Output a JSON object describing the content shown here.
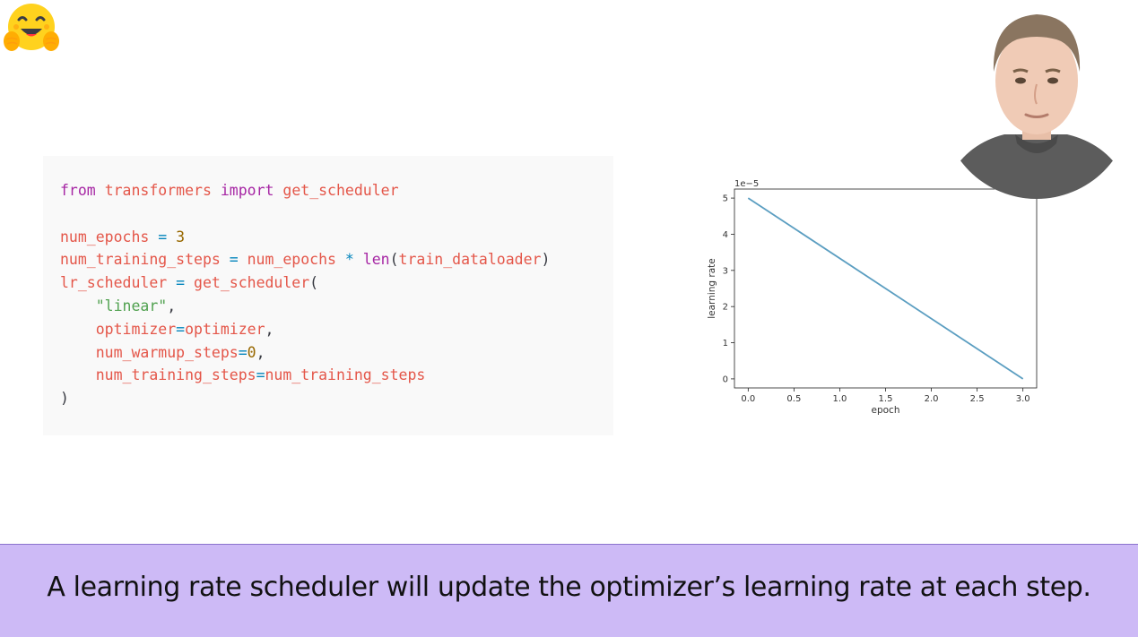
{
  "code": {
    "lines": [
      [
        {
          "t": "from",
          "c": "kw"
        },
        {
          "t": " ",
          "c": "pl"
        },
        {
          "t": "transformers",
          "c": "id"
        },
        {
          "t": " ",
          "c": "pl"
        },
        {
          "t": "import",
          "c": "kw"
        },
        {
          "t": " ",
          "c": "pl"
        },
        {
          "t": "get_scheduler",
          "c": "id"
        }
      ],
      [],
      [
        {
          "t": "num_epochs",
          "c": "id"
        },
        {
          "t": " ",
          "c": "pl"
        },
        {
          "t": "=",
          "c": "op"
        },
        {
          "t": " ",
          "c": "pl"
        },
        {
          "t": "3",
          "c": "num"
        }
      ],
      [
        {
          "t": "num_training_steps",
          "c": "id"
        },
        {
          "t": " ",
          "c": "pl"
        },
        {
          "t": "=",
          "c": "op"
        },
        {
          "t": " ",
          "c": "pl"
        },
        {
          "t": "num_epochs",
          "c": "id"
        },
        {
          "t": " ",
          "c": "pl"
        },
        {
          "t": "*",
          "c": "op"
        },
        {
          "t": " ",
          "c": "pl"
        },
        {
          "t": "len",
          "c": "kw"
        },
        {
          "t": "(",
          "c": "pl"
        },
        {
          "t": "train_dataloader",
          "c": "id"
        },
        {
          "t": ")",
          "c": "pl"
        }
      ],
      [
        {
          "t": "lr_scheduler",
          "c": "id"
        },
        {
          "t": " ",
          "c": "pl"
        },
        {
          "t": "=",
          "c": "op"
        },
        {
          "t": " ",
          "c": "pl"
        },
        {
          "t": "get_scheduler",
          "c": "id"
        },
        {
          "t": "(",
          "c": "pl"
        }
      ],
      [
        {
          "t": "    ",
          "c": "pl"
        },
        {
          "t": "\"linear\"",
          "c": "str"
        },
        {
          "t": ",",
          "c": "pl"
        }
      ],
      [
        {
          "t": "    ",
          "c": "pl"
        },
        {
          "t": "optimizer",
          "c": "id"
        },
        {
          "t": "=",
          "c": "op"
        },
        {
          "t": "optimizer",
          "c": "id"
        },
        {
          "t": ",",
          "c": "pl"
        }
      ],
      [
        {
          "t": "    ",
          "c": "pl"
        },
        {
          "t": "num_warmup_steps",
          "c": "id"
        },
        {
          "t": "=",
          "c": "op"
        },
        {
          "t": "0",
          "c": "num"
        },
        {
          "t": ",",
          "c": "pl"
        }
      ],
      [
        {
          "t": "    ",
          "c": "pl"
        },
        {
          "t": "num_training_steps",
          "c": "id"
        },
        {
          "t": "=",
          "c": "op"
        },
        {
          "t": "num_training_steps",
          "c": "id"
        }
      ],
      [
        {
          "t": ")",
          "c": "pl"
        }
      ]
    ]
  },
  "chart_data": {
    "type": "line",
    "xlabel": "epoch",
    "ylabel": "learning rate",
    "y_scale_label": "1e−5",
    "xlim": [
      -0.15,
      3.15
    ],
    "ylim": [
      -0.25,
      5.25
    ],
    "x_ticks": [
      0.0,
      0.5,
      1.0,
      1.5,
      2.0,
      2.5,
      3.0
    ],
    "x_tick_labels": [
      "0.0",
      "0.5",
      "1.0",
      "1.5",
      "2.0",
      "2.5",
      "3.0"
    ],
    "y_ticks": [
      0,
      1,
      2,
      3,
      4,
      5
    ],
    "y_tick_labels": [
      "0",
      "1",
      "2",
      "3",
      "4",
      "5"
    ],
    "grid": false,
    "series": [
      {
        "x": [
          0.0,
          3.0
        ],
        "y": [
          5.0,
          0.0
        ],
        "color": "#5b9ec1"
      }
    ]
  },
  "caption": {
    "text": "A learning rate scheduler will update the optimizer’s learning rate at each step."
  },
  "colors": {
    "caption_bg": "#cdbaf6",
    "code_bg": "#f9f9f9"
  },
  "icons": {
    "logo": "hugging-face-emoji-icon"
  }
}
